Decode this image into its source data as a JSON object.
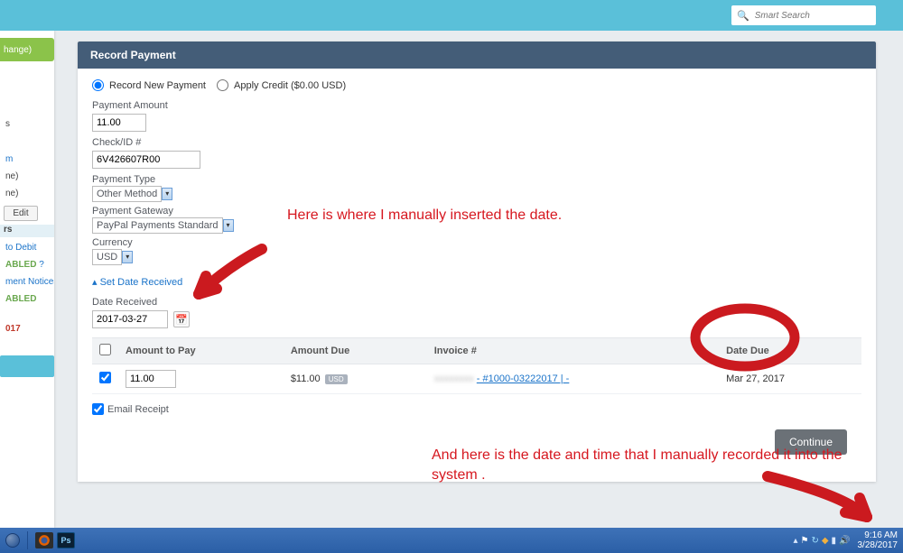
{
  "search": {
    "placeholder": "Smart Search"
  },
  "sidebar": {
    "change": "hange)",
    "edit": "Edit",
    "rs": "rs",
    "to_debit": "to Debit",
    "abled": "ABLED",
    "q": "?",
    "notices": "ment Notices",
    "abled2": "ABLED",
    "yr": "017"
  },
  "panel": {
    "title": "Record Payment",
    "mode": {
      "record_new": "Record New Payment",
      "apply_credit": "Apply Credit ($0.00 USD)"
    },
    "amount_label": "Payment Amount",
    "amount_value": "11.00",
    "check_label": "Check/ID #",
    "check_value": "6V426607R00",
    "type_label": "Payment Type",
    "type_value": "Other Method",
    "gateway_label": "Payment Gateway",
    "gateway_value": "PayPal Payments Standard",
    "currency_label": "Currency",
    "currency_value": "USD",
    "set_date_label": "Set Date Received",
    "date_received_label": "Date Received",
    "date_received_value": "2017-03-27",
    "table": {
      "h_amount_pay": "Amount to Pay",
      "h_amount_due": "Amount Due",
      "h_invoice": "Invoice #",
      "h_date_due": "Date Due",
      "row": {
        "pay": "11.00",
        "due": "$11.00",
        "due_cur": "USD",
        "invoice_blur": "xxxxxxxx",
        "invoice_link": "- #1000-03222017 | -",
        "date_due": "Mar 27, 2017"
      }
    },
    "email_receipt": "Email Receipt",
    "continue": "Continue"
  },
  "annotation": {
    "a1": "Here is where I manually inserted the date.",
    "a2": "And here is the date and time that I manually recorded it into the system ."
  },
  "taskbar": {
    "ps": "Ps",
    "time": "9:16 AM",
    "date": "3/28/2017"
  }
}
